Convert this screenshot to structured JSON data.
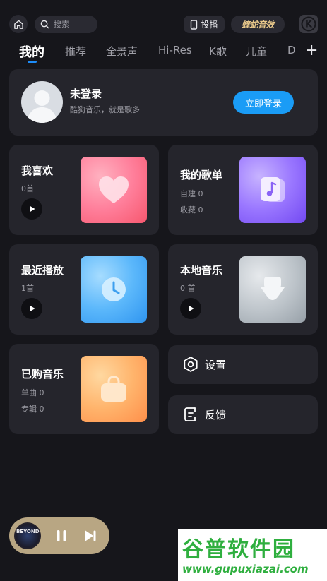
{
  "search": {
    "placeholder": "搜索"
  },
  "header": {
    "cast_label": "投播",
    "viper_label": "蝰蛇音效",
    "k_logo": "K"
  },
  "tabs": [
    {
      "label": "我的",
      "active": true
    },
    {
      "label": "推荐"
    },
    {
      "label": "全景声"
    },
    {
      "label": "Hi-Res"
    },
    {
      "label": "K歌"
    },
    {
      "label": "儿童"
    },
    {
      "label": "D"
    }
  ],
  "tab_add": "+",
  "login": {
    "title": "未登录",
    "subtitle": "酷狗音乐，就是歌多",
    "button": "立即登录"
  },
  "tiles": {
    "favorite": {
      "title": "我喜欢",
      "meta": "0首"
    },
    "playlists": {
      "title": "我的歌单",
      "created": "自建 0",
      "collected": "收藏 0"
    },
    "recent": {
      "title": "最近播放",
      "meta": "1首"
    },
    "local": {
      "title": "本地音乐",
      "meta": "0 首"
    },
    "purchased": {
      "title": "已购音乐",
      "singles": "单曲 0",
      "albums": "专辑 0"
    }
  },
  "settings": {
    "label": "设置"
  },
  "feedback": {
    "label": "反馈"
  },
  "player": {
    "cover_text": "BEYOND"
  },
  "watermark": {
    "title": "谷普软件园",
    "url": "www.gupuxiazai.com"
  },
  "colors": {
    "accent": "#1a9cf6",
    "background": "#16161b",
    "card": "#25252c"
  }
}
